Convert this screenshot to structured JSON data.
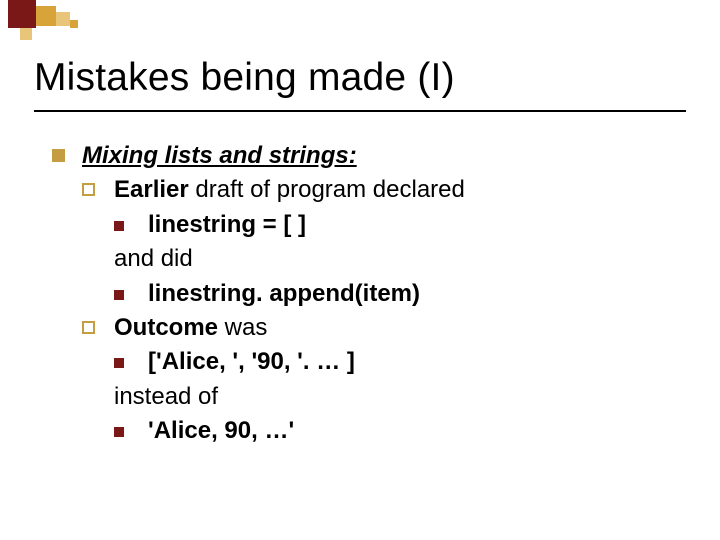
{
  "title": "Mistakes being made (I)",
  "lvl1": {
    "heading": "Mixing lists and strings:"
  },
  "sec1": {
    "lead_bold": "Earlier",
    "lead_rest": " draft of program declared",
    "code1": "linestring = [ ]",
    "mid": "and did",
    "code2": "linestring. append(item)"
  },
  "sec2": {
    "lead_bold": "Outcome",
    "lead_rest": " was",
    "code1": "['Alice, ', '90, '. … ]",
    "mid": "instead of",
    "code2": "'Alice, 90, …'"
  }
}
